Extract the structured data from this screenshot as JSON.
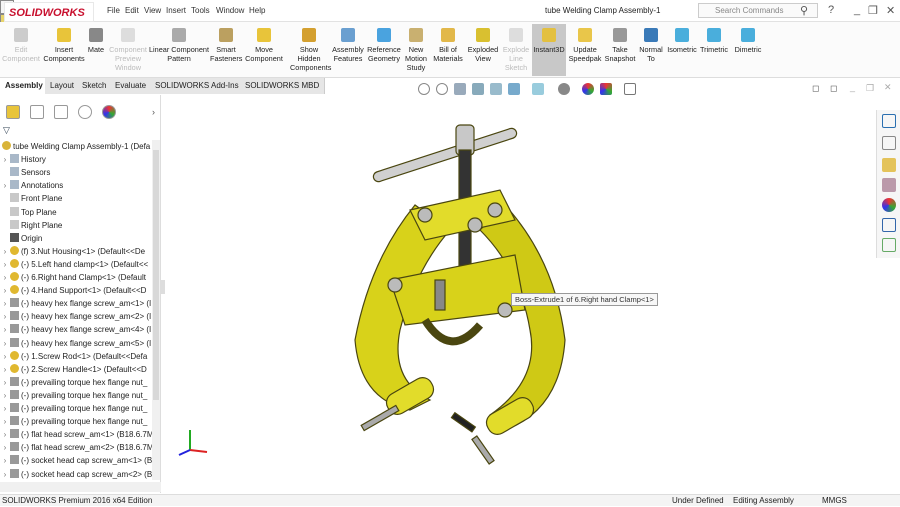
{
  "app": {
    "brand": "SOLIDWORKS",
    "document_title": "tube Welding Clamp Assembly-1",
    "search_placeholder": "Search Commands"
  },
  "menu": [
    "File",
    "Edit",
    "View",
    "Insert",
    "Tools",
    "Window",
    "Help"
  ],
  "ribbon": [
    {
      "label": "Edit Component",
      "disabled": true
    },
    {
      "label": "Insert Components"
    },
    {
      "label": "Mate"
    },
    {
      "label": "Component Preview Window",
      "disabled": true
    },
    {
      "label": "Linear Component Pattern"
    },
    {
      "label": "Smart Fasteners"
    },
    {
      "label": "Move Component"
    },
    {
      "label": "Show Hidden Components"
    },
    {
      "label": "Assembly Features"
    },
    {
      "label": "Reference Geometry"
    },
    {
      "label": "New Motion Study"
    },
    {
      "label": "Bill of Materials"
    },
    {
      "label": "Exploded View"
    },
    {
      "label": "Explode Line Sketch",
      "disabled": true
    },
    {
      "label": "Instant3D",
      "active": true
    },
    {
      "label": "Update Speedpak"
    },
    {
      "label": "Take Snapshot"
    },
    {
      "label": "Normal To"
    },
    {
      "label": "Isometric"
    },
    {
      "label": "Trimetric"
    },
    {
      "label": "Dimetric"
    }
  ],
  "tabs": [
    "Assembly",
    "Layout",
    "Sketch",
    "Evaluate",
    "SOLIDWORKS Add-Ins",
    "SOLIDWORKS MBD"
  ],
  "tree": [
    {
      "label": "tube Welding Clamp Assembly-1  (Defa",
      "icon": "assembly"
    },
    {
      "label": "History",
      "icon": "folder",
      "exp": true
    },
    {
      "label": "Sensors",
      "icon": "folder"
    },
    {
      "label": "Annotations",
      "icon": "folder",
      "exp": true
    },
    {
      "label": "Front Plane",
      "icon": "plane"
    },
    {
      "label": "Top Plane",
      "icon": "plane"
    },
    {
      "label": "Right Plane",
      "icon": "plane"
    },
    {
      "label": "Origin",
      "icon": "origin"
    },
    {
      "label": "(f) 3.Nut Housing<1> (Default<<De",
      "icon": "part",
      "exp": true
    },
    {
      "label": "(-) 5.Left hand clamp<1> (Default<<",
      "icon": "part",
      "exp": true
    },
    {
      "label": "(-) 6.Right hand Clamp<1> (Default",
      "icon": "part",
      "exp": true
    },
    {
      "label": "(-) 4.Hand Support<1> (Default<<D",
      "icon": "part",
      "exp": true
    },
    {
      "label": "(-) heavy hex flange screw_am<1> (I",
      "icon": "screw",
      "exp": true
    },
    {
      "label": "(-) heavy hex flange screw_am<2> (I",
      "icon": "screw",
      "exp": true
    },
    {
      "label": "(-) heavy hex flange screw_am<4> (I",
      "icon": "screw",
      "exp": true
    },
    {
      "label": "(-) heavy hex flange screw_am<5> (I",
      "icon": "screw",
      "exp": true
    },
    {
      "label": "(-) 1.Screw Rod<1> (Default<<Defa",
      "icon": "part",
      "exp": true
    },
    {
      "label": "(-) 2.Screw Handle<1> (Default<<D",
      "icon": "part",
      "exp": true
    },
    {
      "label": "(-) prevailing torque hex flange nut_",
      "icon": "screw",
      "exp": true
    },
    {
      "label": "(-) prevailing torque hex flange nut_",
      "icon": "screw",
      "exp": true
    },
    {
      "label": "(-) prevailing torque hex flange nut_",
      "icon": "screw",
      "exp": true
    },
    {
      "label": "(-) prevailing torque hex flange nut_",
      "icon": "screw",
      "exp": true
    },
    {
      "label": "(-) flat head screw_am<1> (B18.6.7M",
      "icon": "screw",
      "exp": true
    },
    {
      "label": "(-) flat head screw_am<2> (B18.6.7M",
      "icon": "screw",
      "exp": true
    },
    {
      "label": "(-) socket head cap screw_am<1> (B",
      "icon": "screw",
      "exp": true
    },
    {
      "label": "(-) socket head cap screw_am<2> (B",
      "icon": "screw",
      "exp": true
    }
  ],
  "tooltip": "Boss-Extrude1 of 6.Right hand Clamp<1>",
  "status": {
    "edition": "SOLIDWORKS Premium 2016 x64 Edition",
    "state": "Under Defined",
    "mode": "Editing Assembly",
    "units": "MMGS"
  },
  "colors": {
    "brand": "#c8102e",
    "model": "#d8d21a",
    "active": "#c8c8c8"
  }
}
